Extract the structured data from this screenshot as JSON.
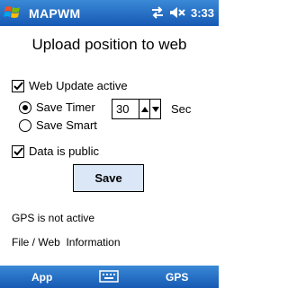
{
  "titlebar": {
    "app_title": "MAPWM",
    "clock": "3:33"
  },
  "icons": {
    "start": "windows-flag-icon",
    "connectivity": "sync-arrows-icon",
    "volume": "speaker-mute-icon",
    "keyboard": "keyboard-icon"
  },
  "main": {
    "heading": "Upload position to web",
    "web_update_label": "Web Update active",
    "web_update_checked": true,
    "save_timer_label": "Save Timer",
    "save_smart_label": "Save Smart",
    "selected_mode": "Save Timer",
    "timer_value": "30",
    "timer_unit": "Sec",
    "public_label": "Data is public",
    "public_checked": true,
    "save_button": "Save",
    "gps_status": "GPS is not active",
    "info_line": "File / Web  Information"
  },
  "menubar": {
    "left_soft_key": "App",
    "right_soft_key": "GPS"
  },
  "colors": {
    "bar_top": "#3a89d6",
    "bar_bottom": "#1659b4",
    "button_fill": "#dbe7f7"
  }
}
